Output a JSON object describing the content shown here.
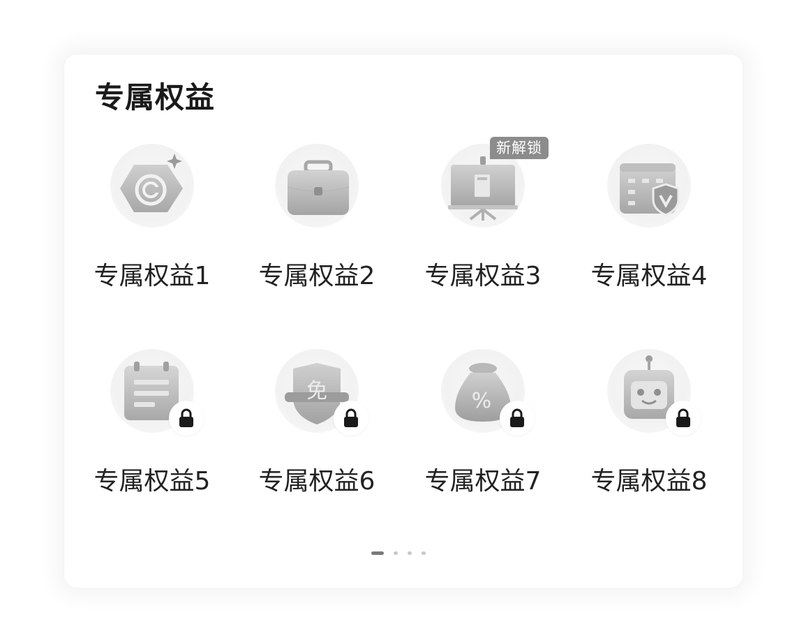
{
  "section": {
    "title": "专属权益",
    "new_badge": "新解锁"
  },
  "items": [
    {
      "label": "专属权益1",
      "icon": "hexagon-coin-icon",
      "locked": false
    },
    {
      "label": "专属权益2",
      "icon": "briefcase-icon",
      "locked": false
    },
    {
      "label": "专属权益3",
      "icon": "presentation-board-icon",
      "locked": false
    },
    {
      "label": "专属权益4",
      "icon": "calendar-shield-icon",
      "locked": false
    },
    {
      "label": "专属权益5",
      "icon": "calendar-note-icon",
      "locked": true
    },
    {
      "label": "专属权益6",
      "icon": "free-tag-shield-icon",
      "locked": true
    },
    {
      "label": "专属权益7",
      "icon": "discount-bag-icon",
      "locked": true
    },
    {
      "label": "专属权益8",
      "icon": "robot-icon",
      "locked": true
    }
  ],
  "pager": {
    "pages": 4,
    "current": 1
  },
  "colors": {
    "background": "#ffffff",
    "title": "#1a1a1a",
    "label": "#222222",
    "icon_gray": "#b5b5b5",
    "badge_bg": "#8c8c8c",
    "lock": "#1a1a1a"
  }
}
